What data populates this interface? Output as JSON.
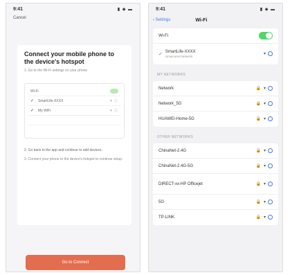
{
  "left": {
    "status_time": "9:41",
    "status_icons": "▮ ◈ ▬",
    "cancel": "Cancel",
    "title": "Connect your mobile phone to the device's hotspot",
    "step": "1. Go to the Wi-Fi settings on your phone",
    "tabs": [
      "",
      ""
    ],
    "mini_rows": [
      {
        "label": "Wi-Fi",
        "icons": "",
        "faded": false,
        "toggle": true
      },
      {
        "label": "SmartLife-XXXX",
        "icons": "▾ ⓘ",
        "faded": false,
        "check": true
      },
      {
        "label": "My WiFi",
        "icons": "▾ ⓘ",
        "faded": false,
        "check": true
      },
      {
        "label": "",
        "icons": "",
        "faded": true
      },
      {
        "label": "",
        "icons": "",
        "faded": true
      }
    ],
    "note": "2. Go back to the app and continue to add devices.",
    "note2_pre": "3. Connect your phone to the device's hotspot to continue setup.",
    "go_button": "Go to Connect"
  },
  "right": {
    "status_time": "9:41",
    "status_icons": "▮ ◈ ▬",
    "back": "‹ Settings",
    "title": "Wi-Fi",
    "wifi_label": "Wi-Fi",
    "connected_name": "SmartLife-XXXX",
    "connected_sub": "Unsecured Network",
    "section_my": "MY NETWORKS",
    "my_networks": [
      "Network",
      "Network_5G",
      "HUAWEI-Home-5G"
    ],
    "section_other": "OTHER NETWORKS",
    "other_networks": [
      "ChinaNet-2.4G",
      "ChinaNet-2.4G-5G",
      "DIRECT-xx-HP Officejet",
      "5G",
      "TP-LINK"
    ],
    "row_icons": "🔒 ▾"
  }
}
